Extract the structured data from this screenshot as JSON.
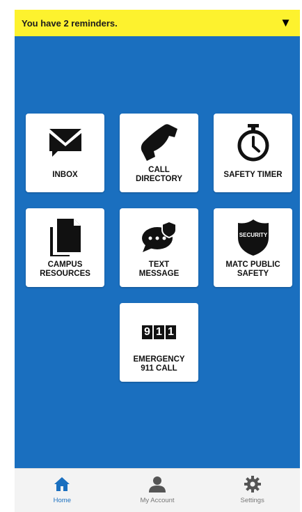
{
  "reminder": {
    "text": "You have 2 reminders.",
    "toggle": "▼"
  },
  "tiles": [
    {
      "id": "inbox",
      "label": "INBOX",
      "icon": "envelope-icon"
    },
    {
      "id": "call-directory",
      "label": "CALL\nDIRECTORY",
      "icon": "phone-icon"
    },
    {
      "id": "safety-timer",
      "label": "SAFETY TIMER",
      "icon": "stopwatch-icon"
    },
    {
      "id": "campus-resources",
      "label": "CAMPUS\nRESOURCES",
      "icon": "documents-icon"
    },
    {
      "id": "text-message",
      "label": "TEXT\nMESSAGE",
      "icon": "chat-bubble-icon"
    },
    {
      "id": "matc-public-safety",
      "label": "MATC PUBLIC\nSAFETY",
      "icon": "security-shield-icon"
    },
    {
      "id": "emergency-911",
      "label": "EMERGENCY\n911 CALL",
      "icon": "911-icon"
    }
  ],
  "icon_text": {
    "shield": "SECURITY",
    "d1": "9",
    "d2": "1",
    "d3": "1"
  },
  "tabs": [
    {
      "label": "Home",
      "icon": "home-icon",
      "active": true
    },
    {
      "label": "My Account",
      "icon": "user-icon",
      "active": false
    },
    {
      "label": "Settings",
      "icon": "gear-icon",
      "active": false
    }
  ],
  "colors": {
    "background": "#1a6fbf",
    "reminder_bar": "#fdf22e",
    "active_tab": "#1a6fbf"
  }
}
